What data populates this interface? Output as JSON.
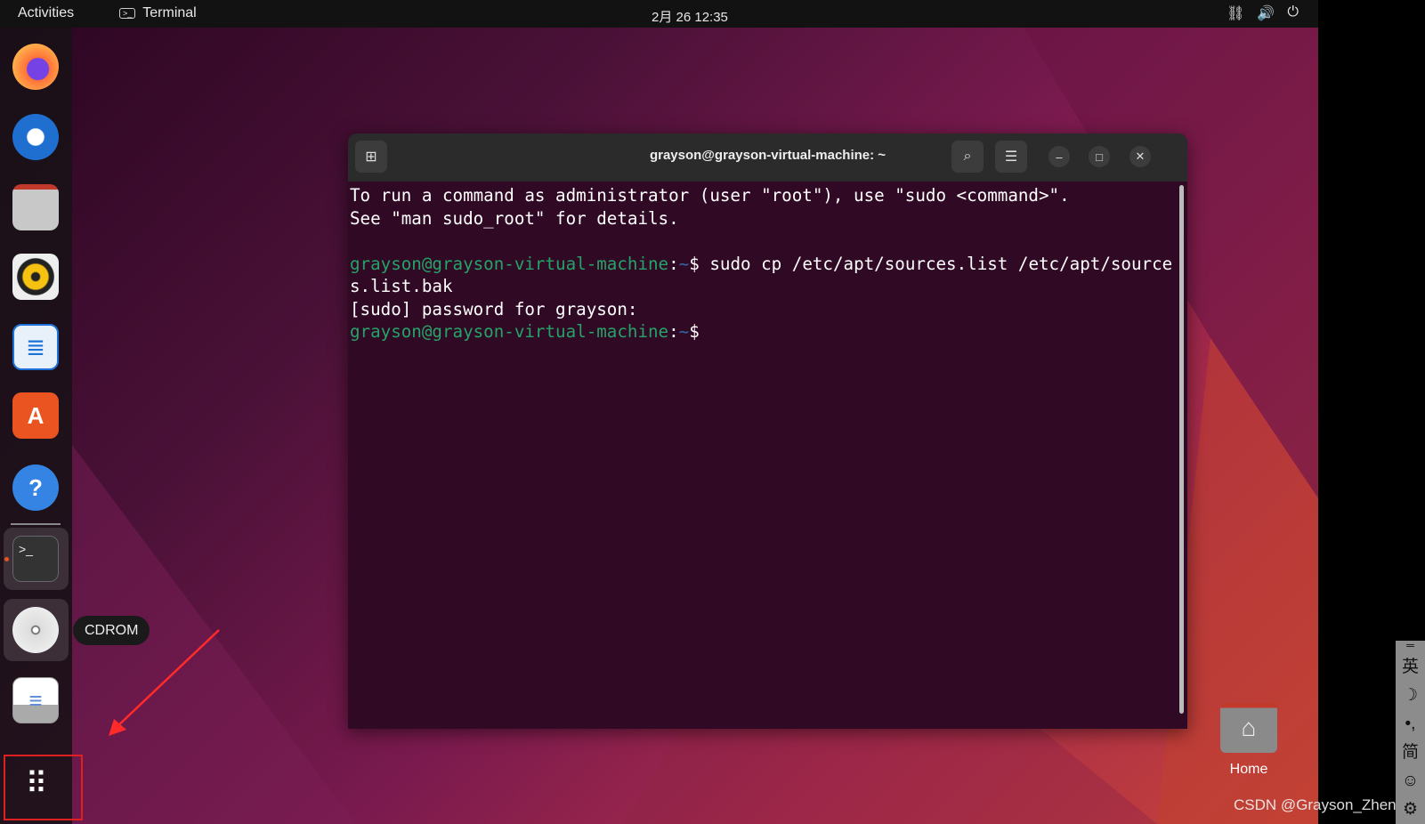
{
  "topbar": {
    "activities": "Activities",
    "app_name": "Terminal",
    "clock": "2月 26  12:35",
    "tray_icons": [
      "network-icon",
      "volume-icon",
      "power-icon"
    ]
  },
  "dock": {
    "items": [
      "firefox",
      "thunderbird",
      "files",
      "rhythmbox",
      "libreoffice-writer",
      "app-center",
      "help",
      "terminal",
      "cdrom",
      "floppy",
      "show-apps"
    ],
    "tooltip": "CDROM"
  },
  "terminal": {
    "title": "grayson@grayson-virtual-machine: ~",
    "lines": {
      "l1": "To run a command as administrator (user \"root\"), use \"sudo <command>\".",
      "l2": "See \"man sudo_root\" for details.",
      "prompt_user": "grayson@grayson-virtual-machine",
      "prompt_colon": ":",
      "prompt_path": "~",
      "prompt_dollar": "$",
      "cmd": " sudo cp /etc/apt/sources.list /etc/apt/source",
      "cmd_wrap": "s.list.bak",
      "sudo_prompt": "[sudo] password for grayson:"
    },
    "colors": {
      "background": "#300a24",
      "user": "#26a269",
      "path": "#3465a4"
    }
  },
  "desktop": {
    "home_label": "Home"
  },
  "watermark": "CSDN @Grayson_Zheng",
  "ime": {
    "items": [
      "英",
      "☽",
      "•,",
      "简",
      "☺",
      "⚙"
    ]
  },
  "annotation": {
    "color": "#e02020"
  }
}
